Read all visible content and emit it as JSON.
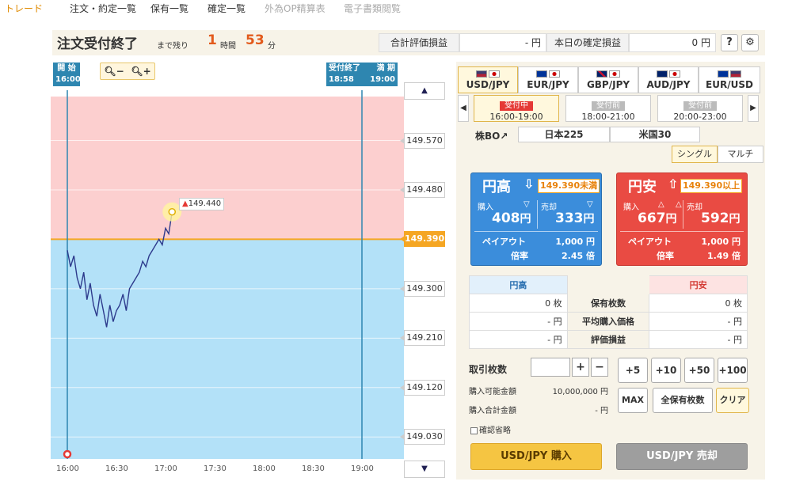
{
  "nav": {
    "items": [
      {
        "label": "トレード",
        "state": "active"
      },
      {
        "label": "注文・約定一覧",
        "state": "normal"
      },
      {
        "label": "保有一覧",
        "state": "normal"
      },
      {
        "label": "確定一覧",
        "state": "normal"
      },
      {
        "label": "外為OP精算表",
        "state": "disabled"
      },
      {
        "label": "電子書類閲覧",
        "state": "disabled"
      }
    ]
  },
  "header": {
    "title": "注文受付終了",
    "remaining_label": "まで残り",
    "hours": "1",
    "hours_unit": "時間",
    "minutes": "53",
    "minutes_unit": "分",
    "total_eval_label": "合計評価損益",
    "total_eval_value": "- 円",
    "today_pl_label": "本日の確定損益",
    "today_pl_value": "0 円",
    "help_label": "?",
    "settings_icon": "gear-icon"
  },
  "chart": {
    "start_box": {
      "label": "開 始",
      "time": "16:00"
    },
    "end_box": {
      "label1": "受付終了",
      "time1": "18:58",
      "label2": "満 期",
      "time2": "19:00"
    },
    "zoom_out_icon": "zoom-out-icon",
    "zoom_in_icon": "zoom-in-icon",
    "current_label": "149.440",
    "x_ticks": [
      "16:00",
      "16:30",
      "17:00",
      "17:30",
      "18:00",
      "18:30",
      "19:00"
    ],
    "price_ticks": [
      "149.570",
      "149.480",
      "149.390",
      "149.300",
      "149.210",
      "149.120",
      "149.030"
    ],
    "strike": "149.390",
    "up_zone_color": "#fccfcf",
    "down_zone_color": "#b3e1f8",
    "strike_line_color": "#f5a623"
  },
  "chart_data": {
    "type": "line",
    "title": "",
    "xlabel": "",
    "ylabel": "",
    "x_range": [
      "16:00",
      "19:00"
    ],
    "ylim": [
      148.99,
      149.65
    ],
    "strike": 149.39,
    "series": [
      {
        "x": [
          "16:00",
          "16:02",
          "16:04",
          "16:06",
          "16:08",
          "16:10",
          "16:12",
          "16:14",
          "16:16",
          "16:18",
          "16:20",
          "16:22",
          "16:24",
          "16:26",
          "16:28",
          "16:30",
          "16:32",
          "16:34",
          "16:36",
          "16:38",
          "16:40",
          "16:42",
          "16:44",
          "16:46",
          "16:48",
          "16:50",
          "16:52",
          "16:54",
          "16:56",
          "16:58",
          "17:00",
          "17:02",
          "17:04"
        ],
        "values": [
          149.37,
          149.34,
          149.36,
          149.32,
          149.3,
          149.33,
          149.28,
          149.31,
          149.27,
          149.25,
          149.29,
          149.26,
          149.23,
          149.27,
          149.24,
          149.26,
          149.27,
          149.29,
          149.26,
          149.3,
          149.31,
          149.32,
          149.33,
          149.35,
          149.34,
          149.36,
          149.37,
          149.38,
          149.39,
          149.38,
          149.41,
          149.4,
          149.44
        ]
      }
    ],
    "grid": true,
    "legend": "none"
  },
  "pairs": [
    {
      "label": "USD/JPY",
      "selected": true
    },
    {
      "label": "EUR/JPY",
      "selected": false
    },
    {
      "label": "GBP/JPY",
      "selected": false
    },
    {
      "label": "AUD/JPY",
      "selected": false
    },
    {
      "label": "EUR/USD",
      "selected": false
    }
  ],
  "sessions": [
    {
      "tag": "受付中",
      "time": "16:00-19:00",
      "live": true
    },
    {
      "tag": "受付前",
      "time": "18:00-21:00",
      "live": false
    },
    {
      "tag": "受付前",
      "time": "20:00-23:00",
      "live": false
    }
  ],
  "markets": {
    "label": "株BO↗",
    "items": [
      "日本225",
      "米国30"
    ]
  },
  "modes": [
    "シングル",
    "マルチ"
  ],
  "up_card": {
    "title": "円高",
    "threshold": "149.390未満",
    "buy_label": "購入",
    "sell_label": "売却",
    "buy_price": "408",
    "sell_price": "333",
    "yen": "円",
    "payout_label": "ペイアウト",
    "payout": "1,000 円",
    "rate_label": "倍率",
    "rate": "2.45 倍"
  },
  "down_card": {
    "title": "円安",
    "threshold": "149.390以上",
    "buy_label": "購入",
    "sell_label": "売却",
    "buy_price": "667",
    "sell_price": "592",
    "yen": "円",
    "payout_label": "ペイアウト",
    "payout": "1,000 円",
    "rate_label": "倍率",
    "rate": "1.49 倍"
  },
  "holdings": {
    "up_header": "円高",
    "down_header": "円安",
    "rows": [
      {
        "label": "保有枚数",
        "up": "0 枚",
        "down": "0 枚"
      },
      {
        "label": "平均購入価格",
        "up": "- 円",
        "down": "- 円"
      },
      {
        "label": "評価損益",
        "up": "- 円",
        "down": "- 円"
      }
    ]
  },
  "order": {
    "qty_label": "取引枚数",
    "qty_value": "",
    "plus": "+",
    "minus": "−",
    "increments": [
      "+5",
      "+10",
      "+50",
      "+100"
    ],
    "avail_label": "購入可能金額",
    "avail_value": "10,000,000 円",
    "total_label": "購入合計金額",
    "total_value": "- 円",
    "max_label": "MAX",
    "all_label": "全保有枚数",
    "clear_label": "クリア",
    "confirm_skip": "確認省略",
    "buy_button": "USD/JPY 購入",
    "sell_button": "USD/JPY 売却"
  }
}
